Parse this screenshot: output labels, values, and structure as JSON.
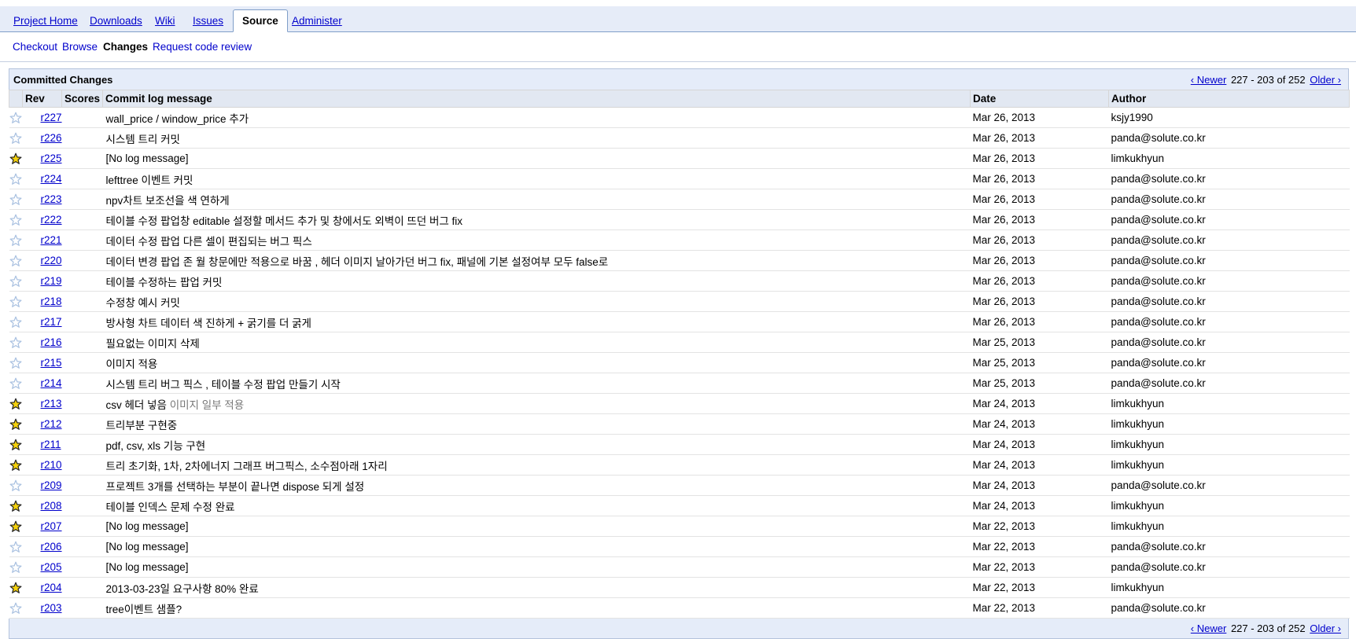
{
  "main_tabs": [
    {
      "label": "Project Home",
      "active": false
    },
    {
      "label": "Downloads",
      "active": false
    },
    {
      "label": "Wiki",
      "active": false
    },
    {
      "label": "Issues",
      "active": false
    },
    {
      "label": "Source",
      "active": true
    },
    {
      "label": "Administer",
      "active": false
    }
  ],
  "sub_tabs": [
    {
      "label": "Checkout",
      "active": false
    },
    {
      "label": "Browse",
      "active": false
    },
    {
      "label": "Changes",
      "active": true
    },
    {
      "label": "Request code review",
      "active": false
    }
  ],
  "table": {
    "title": "Committed Changes",
    "pager": {
      "newer": "‹ Newer",
      "range": "227 - 203 of 252",
      "older": "Older ›"
    },
    "columns": [
      "",
      "Rev",
      "Scores",
      "Commit log message",
      "Date",
      "Author"
    ],
    "rows": [
      {
        "starred": false,
        "rev": "r227",
        "score": "",
        "message": "wall_price / window_price 추가",
        "date": "Mar 26, 2013",
        "author": "ksjy1990"
      },
      {
        "starred": false,
        "rev": "r226",
        "score": "",
        "message": "시스템 트리 커밋",
        "date": "Mar 26, 2013",
        "author": "panda@solute.co.kr"
      },
      {
        "starred": true,
        "rev": "r225",
        "score": "",
        "message": "[No log message]",
        "date": "Mar 26, 2013",
        "author": "limkukhyun"
      },
      {
        "starred": false,
        "rev": "r224",
        "score": "",
        "message": "lefttree 이벤트 커밋",
        "date": "Mar 26, 2013",
        "author": "panda@solute.co.kr"
      },
      {
        "starred": false,
        "rev": "r223",
        "score": "",
        "message": "npv차트 보조선을 색 연하게",
        "date": "Mar 26, 2013",
        "author": "panda@solute.co.kr"
      },
      {
        "starred": false,
        "rev": "r222",
        "score": "",
        "message": "테이블 수정 팝업창 editable 설정할 메서드 추가 및 창에서도 외벽이 뜨던 버그 fix",
        "date": "Mar 26, 2013",
        "author": "panda@solute.co.kr"
      },
      {
        "starred": false,
        "rev": "r221",
        "score": "",
        "message": "데이터 수정 팝업 다른 셀이 편집되는 버그 픽스",
        "date": "Mar 26, 2013",
        "author": "panda@solute.co.kr"
      },
      {
        "starred": false,
        "rev": "r220",
        "score": "",
        "message": "데이터 변경 팝업 존 월 창문에만 적용으로 바꿈 , 헤더 이미지 날아가던 버그 fix, 패널에 기본 설정여부 모두 false로",
        "date": "Mar 26, 2013",
        "author": "panda@solute.co.kr"
      },
      {
        "starred": false,
        "rev": "r219",
        "score": "",
        "message": "테이블 수정하는 팝업 커밋",
        "date": "Mar 26, 2013",
        "author": "panda@solute.co.kr"
      },
      {
        "starred": false,
        "rev": "r218",
        "score": "",
        "message": "수정창 예시 커밋",
        "date": "Mar 26, 2013",
        "author": "panda@solute.co.kr"
      },
      {
        "starred": false,
        "rev": "r217",
        "score": "",
        "message": "방사형 차트 데이터 색 진하게 + 굵기를 더 굵게",
        "date": "Mar 26, 2013",
        "author": "panda@solute.co.kr"
      },
      {
        "starred": false,
        "rev": "r216",
        "score": "",
        "message": "필요없는 이미지 삭제",
        "date": "Mar 25, 2013",
        "author": "panda@solute.co.kr"
      },
      {
        "starred": false,
        "rev": "r215",
        "score": "",
        "message": "이미지 적용",
        "date": "Mar 25, 2013",
        "author": "panda@solute.co.kr"
      },
      {
        "starred": false,
        "rev": "r214",
        "score": "",
        "message": "시스템 트리 버그 픽스 , 테이블 수정 팝업 만들기 시작",
        "date": "Mar 25, 2013",
        "author": "panda@solute.co.kr"
      },
      {
        "starred": true,
        "rev": "r213",
        "score": "",
        "message": "csv 헤더 넣음",
        "message_suffix": " 이미지 일부 적용",
        "date": "Mar 24, 2013",
        "author": "limkukhyun"
      },
      {
        "starred": true,
        "rev": "r212",
        "score": "",
        "message": "트리부분 구현중",
        "date": "Mar 24, 2013",
        "author": "limkukhyun"
      },
      {
        "starred": true,
        "rev": "r211",
        "score": "",
        "message": "pdf, csv, xls 기능 구현",
        "date": "Mar 24, 2013",
        "author": "limkukhyun"
      },
      {
        "starred": true,
        "rev": "r210",
        "score": "",
        "message": "트리 초기화, 1차, 2차에너지 그래프 버그픽스, 소수점아래 1자리",
        "date": "Mar 24, 2013",
        "author": "limkukhyun"
      },
      {
        "starred": false,
        "rev": "r209",
        "score": "",
        "message": "프로젝트 3개를 선택하는 부분이 끝나면 dispose 되게 설정",
        "date": "Mar 24, 2013",
        "author": "panda@solute.co.kr"
      },
      {
        "starred": true,
        "rev": "r208",
        "score": "",
        "message": "테이블 인덱스 문제 수정 완료",
        "date": "Mar 24, 2013",
        "author": "limkukhyun"
      },
      {
        "starred": true,
        "rev": "r207",
        "score": "",
        "message": "[No log message]",
        "date": "Mar 22, 2013",
        "author": "limkukhyun"
      },
      {
        "starred": false,
        "rev": "r206",
        "score": "",
        "message": "[No log message]",
        "date": "Mar 22, 2013",
        "author": "panda@solute.co.kr"
      },
      {
        "starred": false,
        "rev": "r205",
        "score": "",
        "message": "[No log message]",
        "date": "Mar 22, 2013",
        "author": "panda@solute.co.kr"
      },
      {
        "starred": true,
        "rev": "r204",
        "score": "",
        "message": "2013-03-23일 요구사항 80% 완료",
        "date": "Mar 22, 2013",
        "author": "limkukhyun"
      },
      {
        "starred": false,
        "rev": "r203",
        "score": "",
        "message": "tree이벤트 샘플?",
        "date": "Mar 22, 2013",
        "author": "panda@solute.co.kr"
      }
    ]
  },
  "colors": {
    "link": "#0000cc",
    "tabbar_bg": "#e6ecf8",
    "header_bg": "#e5ecf9",
    "star_filled": "#f5d20b",
    "star_outline": "#a8c0e0"
  }
}
